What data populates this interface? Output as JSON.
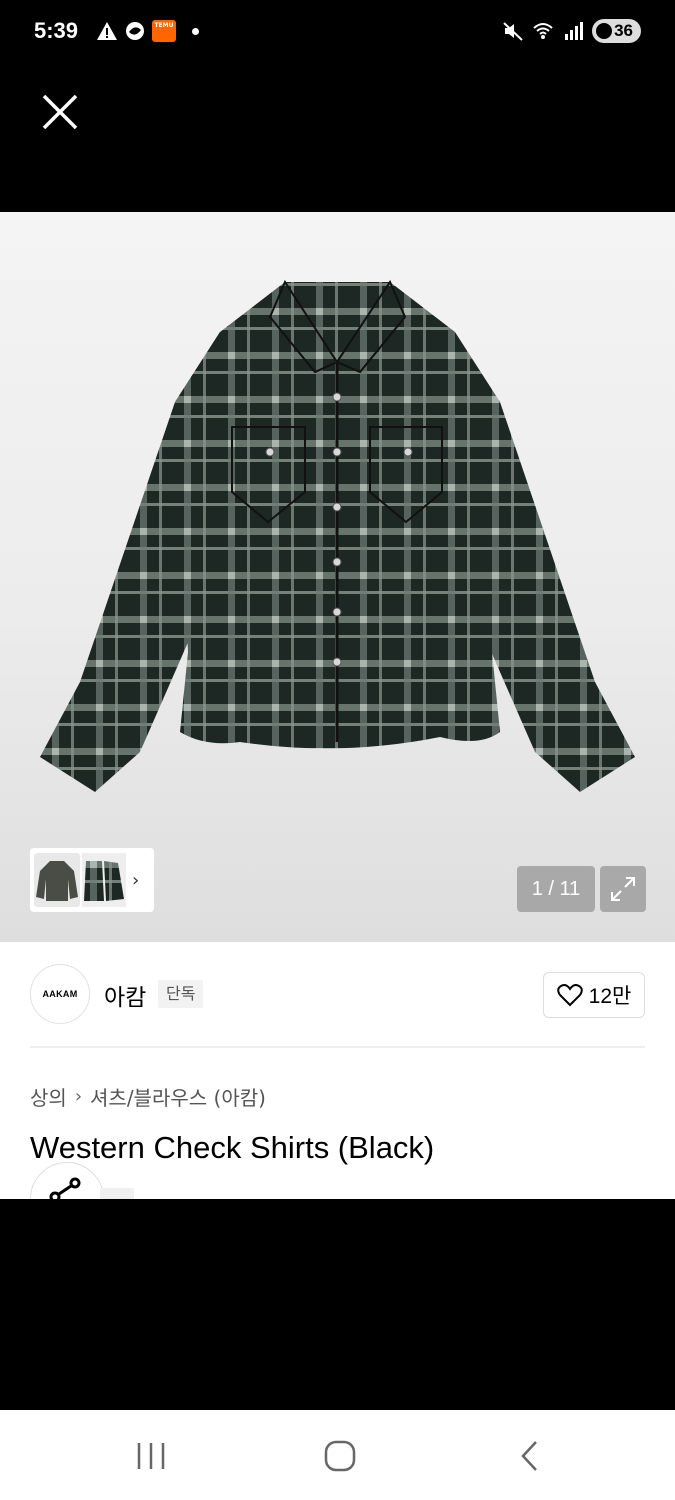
{
  "status_bar": {
    "time": "5:39",
    "temu_badge_text": "TEMU",
    "battery_level": "36",
    "left_icons": [
      "warning-icon",
      "gemini-icon",
      "temu-icon",
      "dot-icon"
    ],
    "right_icons": [
      "mute-icon",
      "wifi-icon",
      "signal-icon",
      "battery-icon"
    ]
  },
  "gallery": {
    "counter": "1 / 11",
    "current_index": 1,
    "total_images": 11,
    "shirt_colors": [
      "#1d2724",
      "#7f8d86"
    ]
  },
  "brand": {
    "logo_text": "AAKAM",
    "name": "아캄",
    "badge": "단독",
    "likes": "12만"
  },
  "breadcrumb": {
    "category": "상의",
    "subcategory": "셔츠/블라우스 (아캄)"
  },
  "product": {
    "title": "Western Check Shirts (Black)"
  },
  "nav": {
    "icons": [
      "recent-apps-icon",
      "home-icon",
      "back-icon"
    ]
  }
}
